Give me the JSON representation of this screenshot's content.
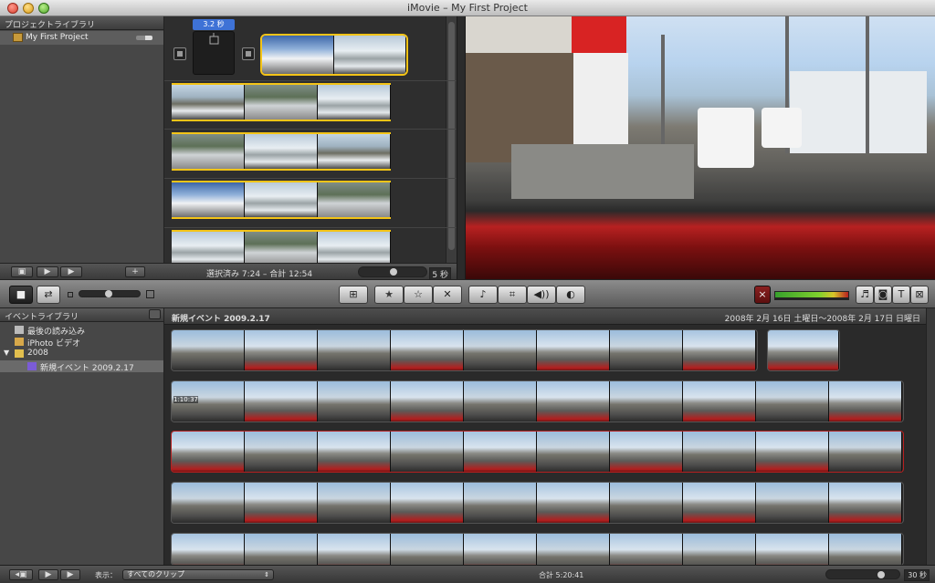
{
  "window": {
    "title": "iMovie – My First Project"
  },
  "project_library": {
    "header": "プロジェクトライブラリ",
    "items": [
      {
        "label": "My First Project"
      }
    ]
  },
  "project": {
    "transition_duration": "3.2 秒",
    "status": "選択済み 7:24 – 合計 12:54",
    "zoom_value": "5 秒"
  },
  "event_library": {
    "header": "イベントライブラリ",
    "items": [
      {
        "label": "最後の読み込み",
        "icon": "film-icon"
      },
      {
        "label": "iPhoto ビデオ",
        "icon": "iphoto-icon"
      },
      {
        "label": "2008",
        "icon": "folder-icon"
      },
      {
        "label": "新規イベント 2009.2.17",
        "icon": "event-icon"
      }
    ]
  },
  "event_browser": {
    "title": "新規イベント 2009.2.17",
    "date_range": "2008年 2月 16日 土曜日〜2008年 2月 17日 日曜日",
    "clip_timecode": "1:10:37"
  },
  "bottom_bar": {
    "show_label": "表示：",
    "filter_value": "すべてのクリップ",
    "total": "合計 5:20:41",
    "zoom_value": "30 秒"
  },
  "colors": {
    "selection": "#f4c417",
    "duration_tag": "#3e72d6",
    "rejected_red": "#b72020"
  }
}
